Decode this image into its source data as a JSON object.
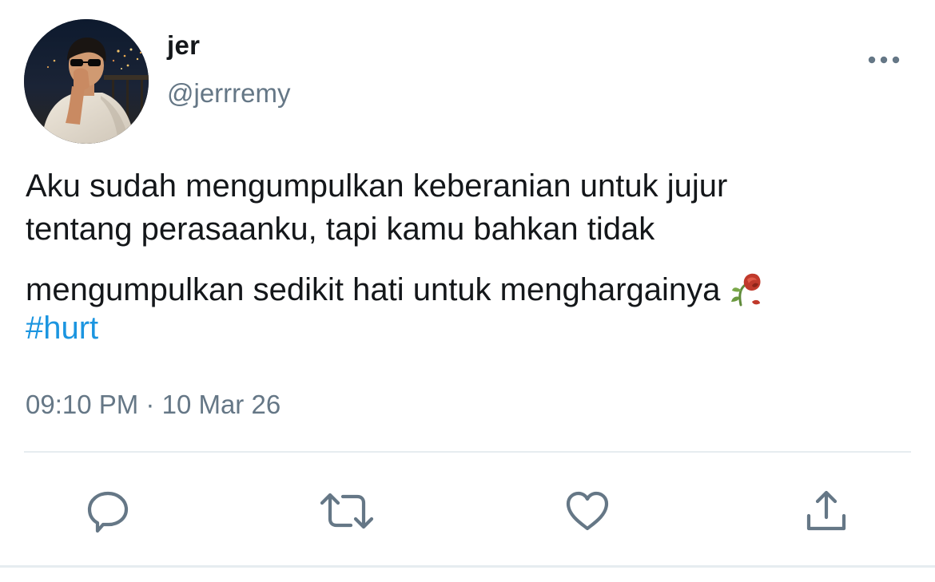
{
  "tweet": {
    "author": {
      "display_name": "jer",
      "handle": "@jerrremy",
      "avatar_icon": "profile-photo"
    },
    "text_lines": [
      "Aku sudah mengumpulkan keberanian untuk jujur",
      "tentang perasaanku, tapi kamu bahkan tidak",
      "mengumpulkan sedikit hati untuk menghargainya"
    ],
    "emoji": "wilted-flower",
    "hashtag": "#hurt",
    "time": "09:10 PM",
    "separator": "·",
    "date": "10 Mar 26"
  },
  "actions": {
    "more": "more-icon",
    "reply": "reply-icon",
    "retweet": "retweet-icon",
    "like": "heart-icon",
    "share": "share-icon"
  },
  "colors": {
    "text": "#14171a",
    "secondary": "#657786",
    "link": "#1b95e0",
    "divider": "#e6ecf0"
  }
}
